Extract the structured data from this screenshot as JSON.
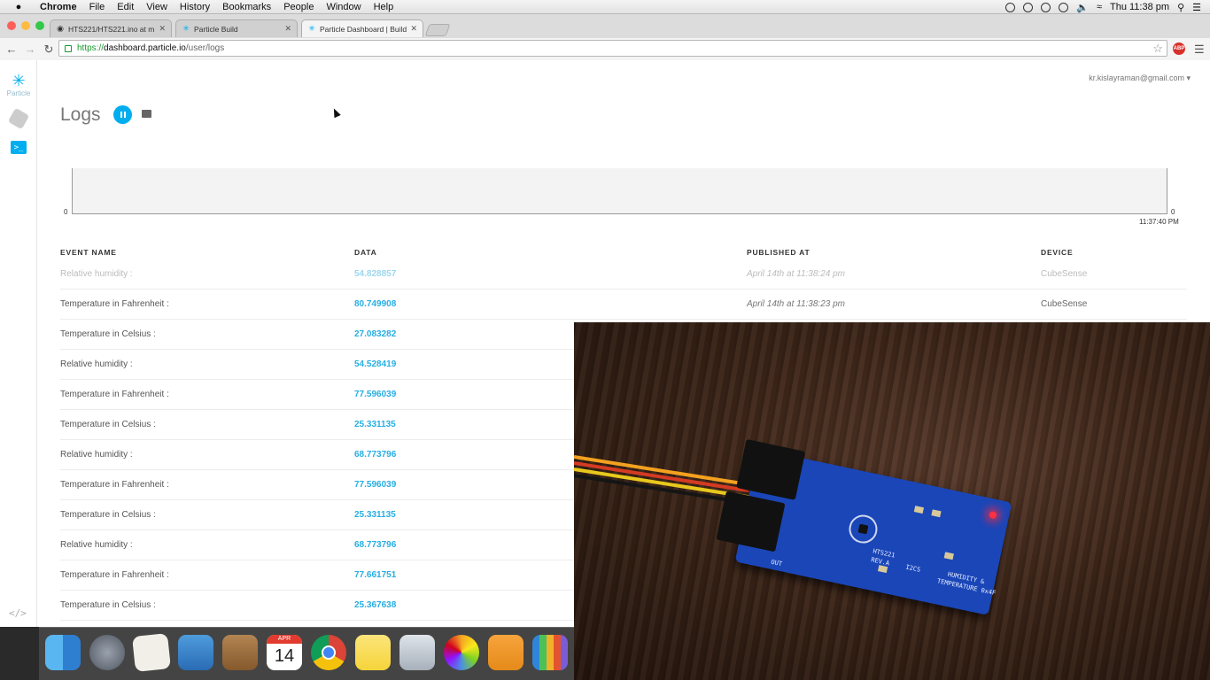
{
  "menubar": {
    "app": "Chrome",
    "items": [
      "File",
      "Edit",
      "View",
      "History",
      "Bookmarks",
      "People",
      "Window",
      "Help"
    ],
    "clock": "Thu 11:38 pm"
  },
  "tabs": [
    {
      "label": "HTS221/HTS221.ino at m",
      "icon": "github-icon"
    },
    {
      "label": "Particle Build",
      "icon": "particle-icon"
    },
    {
      "label": "Particle Dashboard | Build",
      "icon": "particle-icon"
    }
  ],
  "address": {
    "scheme": "https://",
    "host": "dashboard.particle.io",
    "path": "/user/logs"
  },
  "sidebar": {
    "logo_label": "Particle",
    "code_label": "</>"
  },
  "header": {
    "user": "kr.kislayraman@gmail.com",
    "title": "Logs"
  },
  "chart": {
    "y_left": "0",
    "y_right": "0",
    "x_time": "11:37:40 PM"
  },
  "table": {
    "headers": {
      "event": "EVENT NAME",
      "data": "DATA",
      "published": "PUBLISHED AT",
      "device": "DEVICE"
    },
    "rows": [
      {
        "event": "Relative humidity :",
        "data": "54.828857",
        "published": "April 14th at 11:38:24 pm",
        "device": "CubeSense"
      },
      {
        "event": "Temperature in Fahrenheit :",
        "data": "80.749908",
        "published": "April 14th at 11:38:23 pm",
        "device": "CubeSense"
      },
      {
        "event": "Temperature in Celsius :",
        "data": "27.083282",
        "published": "",
        "device": ""
      },
      {
        "event": "Relative humidity :",
        "data": "54.528419",
        "published": "",
        "device": ""
      },
      {
        "event": "Temperature in Fahrenheit :",
        "data": "77.596039",
        "published": "",
        "device": ""
      },
      {
        "event": "Temperature in Celsius :",
        "data": "25.331135",
        "published": "",
        "device": ""
      },
      {
        "event": "Relative humidity :",
        "data": "68.773796",
        "published": "",
        "device": ""
      },
      {
        "event": "Temperature in Fahrenheit :",
        "data": "77.596039",
        "published": "",
        "device": ""
      },
      {
        "event": "Temperature in Celsius :",
        "data": "25.331135",
        "published": "",
        "device": ""
      },
      {
        "event": "Relative humidity :",
        "data": "68.773796",
        "published": "",
        "device": ""
      },
      {
        "event": "Temperature in Fahrenheit :",
        "data": "77.661751",
        "published": "",
        "device": ""
      },
      {
        "event": "Temperature in Celsius :",
        "data": "25.367638",
        "published": "",
        "device": ""
      }
    ]
  },
  "board": {
    "label1": "HTS221",
    "label2": "REV.A",
    "label3": "I2CS",
    "label4": "HUMIDITY &",
    "label5": "TEMPERATURE 0x4F",
    "label6": "OUT"
  },
  "dock": {
    "calendar_month": "APR",
    "calendar_day": "14"
  },
  "colors": {
    "accent": "#00aeef",
    "data_value": "#27aee2"
  }
}
